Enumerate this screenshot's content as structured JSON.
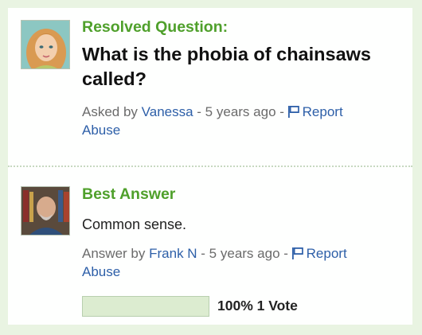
{
  "question": {
    "label": "Resolved Question:",
    "title": "What is the phobia of chainsaws called?",
    "asked_prefix": "Asked by",
    "asker": "Vanessa",
    "time": " - 5 years ago - ",
    "report": "Report",
    "report2": "Abuse"
  },
  "answer": {
    "label": "Best Answer",
    "text": "Common sense.",
    "answer_prefix": "Answer by",
    "answerer": "Frank N",
    "time": " - 5 years ago - ",
    "report": "Report",
    "report2": "Abuse",
    "vote_percent": 100,
    "vote_text": "100% 1 Vote"
  },
  "colors": {
    "accent": "#4fa02b",
    "link": "#2d5fa8",
    "background": "#e9f4e2"
  }
}
